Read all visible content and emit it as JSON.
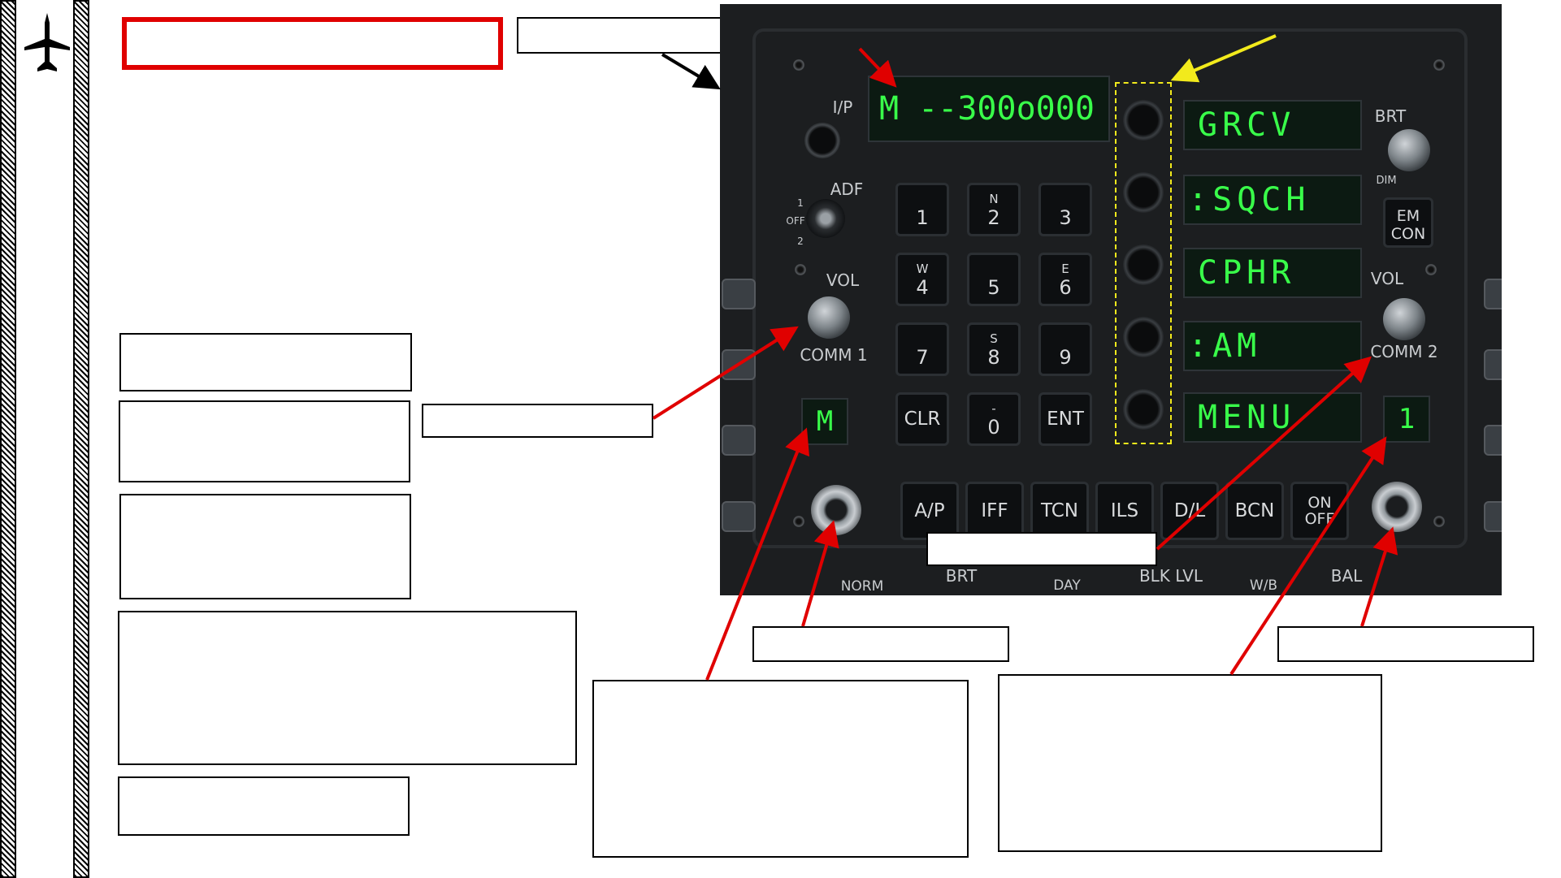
{
  "panel": {
    "io_label": "I/P",
    "adf_label": "ADF",
    "adf_pos_1": "1",
    "adf_pos_off": "OFF",
    "adf_pos_2": "2",
    "vol_left": "VOL",
    "vol_right": "VOL",
    "comm1_label": "COMM 1",
    "comm2_label": "COMM 2",
    "brt_label": "BRT",
    "dim_label": "DIM",
    "emcon_line1": "EM",
    "emcon_line2": "CON",
    "scratchpad": "M --300o000",
    "comm1_channel": "M",
    "comm2_channel": "1",
    "options": [
      "GRCV",
      ":SQCH",
      "CPHR",
      ":AM",
      "MENU"
    ],
    "keypad": [
      {
        "sup": "",
        "main": "1"
      },
      {
        "sup": "N",
        "main": "2"
      },
      {
        "sup": "",
        "main": "3"
      },
      {
        "sup": "W",
        "main": "4"
      },
      {
        "sup": "",
        "main": "5"
      },
      {
        "sup": "E",
        "main": "6"
      },
      {
        "sup": "",
        "main": "7"
      },
      {
        "sup": "S",
        "main": "8"
      },
      {
        "sup": "",
        "main": "9"
      },
      {
        "sup": "",
        "main": "CLR"
      },
      {
        "sup": "-",
        "main": "0"
      },
      {
        "sup": "",
        "main": "ENT"
      }
    ],
    "function_buttons": [
      "A/P",
      "IFF",
      "TCN",
      "ILS",
      "D/L",
      "BCN"
    ],
    "on_off_line1": "ON",
    "on_off_line2": "OFF",
    "bottom_labels": {
      "norm": "NORM",
      "brt": "BRT",
      "day": "DAY",
      "blk_lvl": "BLK LVL",
      "wb": "W/B",
      "bal": "BAL"
    }
  },
  "colors": {
    "lcd_green": "#39ff4a",
    "arrow_red": "#e00000",
    "arrow_yellow": "#f2ea1c",
    "highlight_box": "#e00000"
  }
}
